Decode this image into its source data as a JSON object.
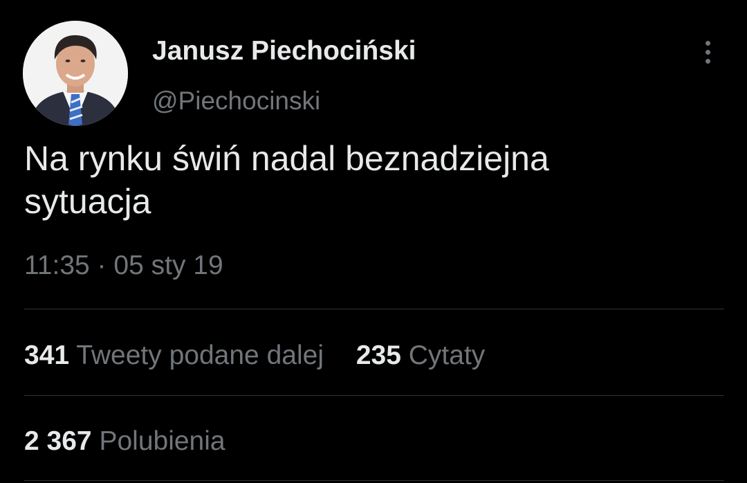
{
  "author": {
    "display_name": "Janusz Piechociński",
    "handle": "@Piechocinski"
  },
  "tweet": {
    "text_line1": "Na rynku świń nadal beznadziejna",
    "text_line2": "sytuacja",
    "time": "11:35",
    "separator": "·",
    "date": "05 sty 19"
  },
  "stats": {
    "retweets_count": "341",
    "retweets_label": "Tweety podane dalej",
    "quotes_count": "235",
    "quotes_label": "Cytaty",
    "likes_count": "2 367",
    "likes_label": "Polubienia"
  },
  "icons": {
    "more": "more-vertical-icon"
  },
  "colors": {
    "background": "#000000",
    "primary_text": "#e7e9ea",
    "secondary_text": "#71767b",
    "divider": "#2f3336"
  }
}
